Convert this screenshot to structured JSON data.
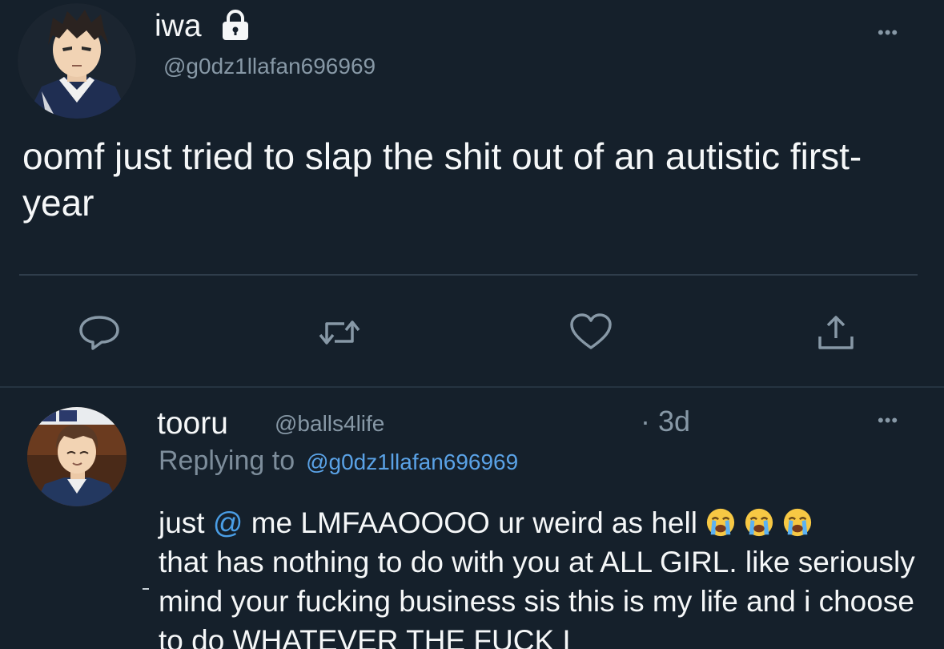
{
  "tweet": {
    "display_name": "iwa",
    "lock_icon": "lock-icon",
    "handle": "@g0dz1llafan696969",
    "more_label": "•••",
    "text": "oomf  just tried to slap the shit out of an autistic first-year",
    "actions": [
      "reply-icon",
      "retweet-icon",
      "like-icon",
      "share-icon"
    ]
  },
  "reply": {
    "display_name": "tooru",
    "handle": "@balls4life",
    "time": "· 3d",
    "more_label": "•••",
    "replying_label": "Replying to",
    "replying_mention": "@g0dz1llafan696969",
    "text_prefix": "just ",
    "text_mention": "@",
    "text_line1": " me LMFAAOOOO ur weird as hell",
    "emoji": [
      "loudly-crying-face",
      "loudly-crying-face",
      "loudly-crying-face"
    ],
    "text_rest": "that has nothing to do with you at ALL GIRL. like seriously mind your fucking business sis this is my life and i choose to do WHATEVER THE FUCK I"
  },
  "colors": {
    "background": "#15202b",
    "text": "#f5f7f8",
    "secondary": "#8798a6",
    "link": "#4a9ee6",
    "divider": "#2f3d4b"
  }
}
